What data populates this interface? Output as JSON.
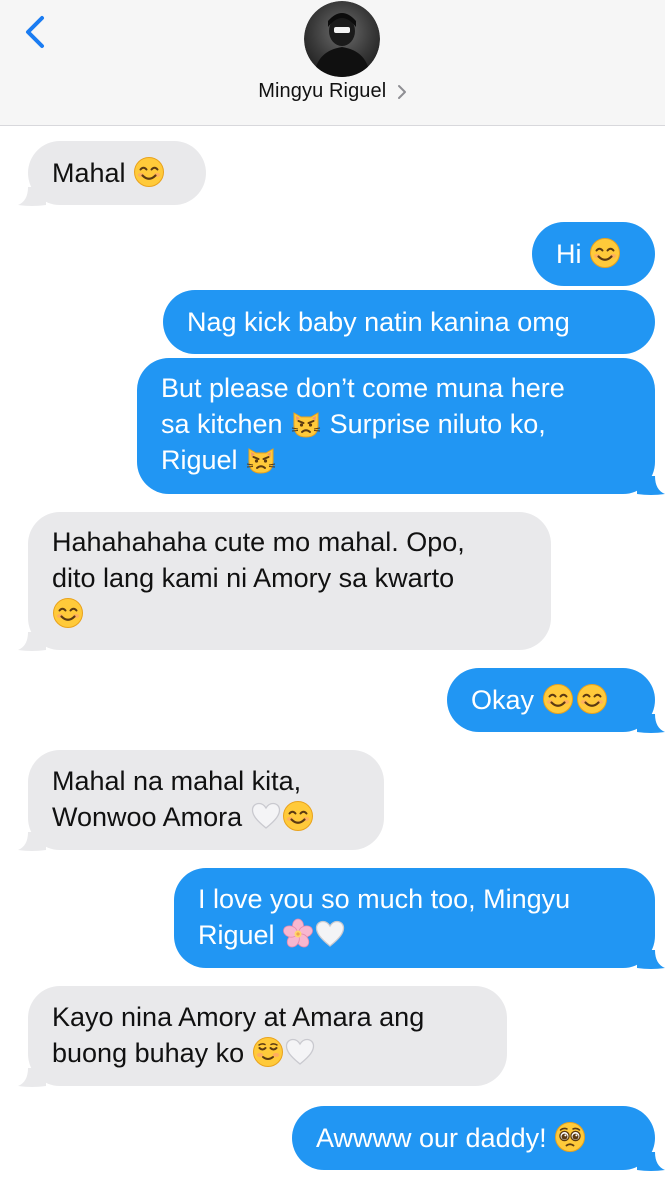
{
  "header": {
    "contact_name": "Mingyu Riguel",
    "back_icon": "chevron-left-icon",
    "info_icon": "chevron-right-icon"
  },
  "colors": {
    "sent_bubble": "#2196f3",
    "received_bubble": "#e9e9eb",
    "header_bg": "#f6f6f6",
    "accent": "#1a7cf2"
  },
  "messages": [
    {
      "direction": "received",
      "lines": [
        "Mahal"
      ],
      "emoji": [
        "smiling-face-icon"
      ]
    },
    {
      "direction": "sent",
      "lines": [
        "Hi"
      ],
      "emoji": [
        "smiling-face-icon"
      ]
    },
    {
      "direction": "sent",
      "lines": [
        "Nag kick baby natin kanina omg"
      ]
    },
    {
      "direction": "sent",
      "lines": [
        "But please don’t come muna here",
        "sa kitchen",
        "Surprise niluto ko,",
        "Riguel"
      ],
      "emoji": [
        "pouting-cat-icon"
      ]
    },
    {
      "direction": "received",
      "lines": [
        "Hahahahaha cute mo mahal. Opo,",
        "dito lang kami ni Amory sa kwarto"
      ],
      "emoji": [
        "smiling-face-icon"
      ]
    },
    {
      "direction": "sent",
      "lines": [
        "Okay"
      ],
      "emoji": [
        "smiling-face-icon"
      ]
    },
    {
      "direction": "received",
      "lines": [
        "Mahal na mahal kita,",
        "Wonwoo Amora"
      ],
      "emoji": [
        "white-heart-icon",
        "smiling-face-icon"
      ]
    },
    {
      "direction": "sent",
      "lines": [
        "I love you so much too, Mingyu",
        "Riguel"
      ],
      "emoji": [
        "cherry-blossom-icon",
        "white-heart-icon"
      ]
    },
    {
      "direction": "received",
      "lines": [
        "Kayo nina Amory at Amara ang",
        "buong buhay ko"
      ],
      "emoji": [
        "relieved-face-icon",
        "white-heart-icon"
      ]
    },
    {
      "direction": "sent",
      "lines": [
        "Awwww our daddy!"
      ],
      "emoji": [
        "pleading-face-icon"
      ]
    }
  ]
}
